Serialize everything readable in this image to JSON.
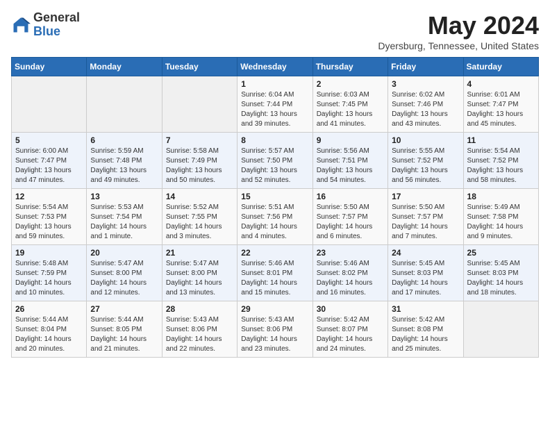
{
  "header": {
    "logo_line1": "General",
    "logo_line2": "Blue",
    "month_title": "May 2024",
    "location": "Dyersburg, Tennessee, United States"
  },
  "weekdays": [
    "Sunday",
    "Monday",
    "Tuesday",
    "Wednesday",
    "Thursday",
    "Friday",
    "Saturday"
  ],
  "weeks": [
    [
      {
        "day": "",
        "info": ""
      },
      {
        "day": "",
        "info": ""
      },
      {
        "day": "",
        "info": ""
      },
      {
        "day": "1",
        "info": "Sunrise: 6:04 AM\nSunset: 7:44 PM\nDaylight: 13 hours\nand 39 minutes."
      },
      {
        "day": "2",
        "info": "Sunrise: 6:03 AM\nSunset: 7:45 PM\nDaylight: 13 hours\nand 41 minutes."
      },
      {
        "day": "3",
        "info": "Sunrise: 6:02 AM\nSunset: 7:46 PM\nDaylight: 13 hours\nand 43 minutes."
      },
      {
        "day": "4",
        "info": "Sunrise: 6:01 AM\nSunset: 7:47 PM\nDaylight: 13 hours\nand 45 minutes."
      }
    ],
    [
      {
        "day": "5",
        "info": "Sunrise: 6:00 AM\nSunset: 7:47 PM\nDaylight: 13 hours\nand 47 minutes."
      },
      {
        "day": "6",
        "info": "Sunrise: 5:59 AM\nSunset: 7:48 PM\nDaylight: 13 hours\nand 49 minutes."
      },
      {
        "day": "7",
        "info": "Sunrise: 5:58 AM\nSunset: 7:49 PM\nDaylight: 13 hours\nand 50 minutes."
      },
      {
        "day": "8",
        "info": "Sunrise: 5:57 AM\nSunset: 7:50 PM\nDaylight: 13 hours\nand 52 minutes."
      },
      {
        "day": "9",
        "info": "Sunrise: 5:56 AM\nSunset: 7:51 PM\nDaylight: 13 hours\nand 54 minutes."
      },
      {
        "day": "10",
        "info": "Sunrise: 5:55 AM\nSunset: 7:52 PM\nDaylight: 13 hours\nand 56 minutes."
      },
      {
        "day": "11",
        "info": "Sunrise: 5:54 AM\nSunset: 7:52 PM\nDaylight: 13 hours\nand 58 minutes."
      }
    ],
    [
      {
        "day": "12",
        "info": "Sunrise: 5:54 AM\nSunset: 7:53 PM\nDaylight: 13 hours\nand 59 minutes."
      },
      {
        "day": "13",
        "info": "Sunrise: 5:53 AM\nSunset: 7:54 PM\nDaylight: 14 hours\nand 1 minute."
      },
      {
        "day": "14",
        "info": "Sunrise: 5:52 AM\nSunset: 7:55 PM\nDaylight: 14 hours\nand 3 minutes."
      },
      {
        "day": "15",
        "info": "Sunrise: 5:51 AM\nSunset: 7:56 PM\nDaylight: 14 hours\nand 4 minutes."
      },
      {
        "day": "16",
        "info": "Sunrise: 5:50 AM\nSunset: 7:57 PM\nDaylight: 14 hours\nand 6 minutes."
      },
      {
        "day": "17",
        "info": "Sunrise: 5:50 AM\nSunset: 7:57 PM\nDaylight: 14 hours\nand 7 minutes."
      },
      {
        "day": "18",
        "info": "Sunrise: 5:49 AM\nSunset: 7:58 PM\nDaylight: 14 hours\nand 9 minutes."
      }
    ],
    [
      {
        "day": "19",
        "info": "Sunrise: 5:48 AM\nSunset: 7:59 PM\nDaylight: 14 hours\nand 10 minutes."
      },
      {
        "day": "20",
        "info": "Sunrise: 5:47 AM\nSunset: 8:00 PM\nDaylight: 14 hours\nand 12 minutes."
      },
      {
        "day": "21",
        "info": "Sunrise: 5:47 AM\nSunset: 8:00 PM\nDaylight: 14 hours\nand 13 minutes."
      },
      {
        "day": "22",
        "info": "Sunrise: 5:46 AM\nSunset: 8:01 PM\nDaylight: 14 hours\nand 15 minutes."
      },
      {
        "day": "23",
        "info": "Sunrise: 5:46 AM\nSunset: 8:02 PM\nDaylight: 14 hours\nand 16 minutes."
      },
      {
        "day": "24",
        "info": "Sunrise: 5:45 AM\nSunset: 8:03 PM\nDaylight: 14 hours\nand 17 minutes."
      },
      {
        "day": "25",
        "info": "Sunrise: 5:45 AM\nSunset: 8:03 PM\nDaylight: 14 hours\nand 18 minutes."
      }
    ],
    [
      {
        "day": "26",
        "info": "Sunrise: 5:44 AM\nSunset: 8:04 PM\nDaylight: 14 hours\nand 20 minutes."
      },
      {
        "day": "27",
        "info": "Sunrise: 5:44 AM\nSunset: 8:05 PM\nDaylight: 14 hours\nand 21 minutes."
      },
      {
        "day": "28",
        "info": "Sunrise: 5:43 AM\nSunset: 8:06 PM\nDaylight: 14 hours\nand 22 minutes."
      },
      {
        "day": "29",
        "info": "Sunrise: 5:43 AM\nSunset: 8:06 PM\nDaylight: 14 hours\nand 23 minutes."
      },
      {
        "day": "30",
        "info": "Sunrise: 5:42 AM\nSunset: 8:07 PM\nDaylight: 14 hours\nand 24 minutes."
      },
      {
        "day": "31",
        "info": "Sunrise: 5:42 AM\nSunset: 8:08 PM\nDaylight: 14 hours\nand 25 minutes."
      },
      {
        "day": "",
        "info": ""
      }
    ]
  ]
}
